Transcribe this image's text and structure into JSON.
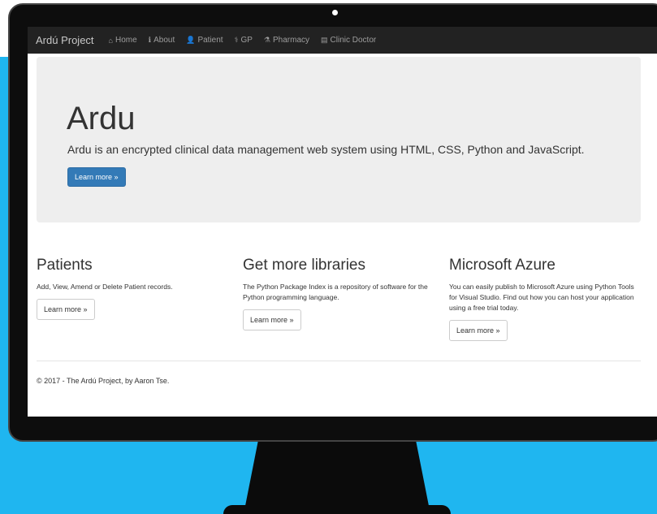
{
  "navbar": {
    "brand": "Ardú Project",
    "items": [
      {
        "icon": "home-icon",
        "glyph": "⌂",
        "label": "Home"
      },
      {
        "icon": "info-icon",
        "glyph": "ℹ",
        "label": "About"
      },
      {
        "icon": "user-icon",
        "glyph": "👤",
        "label": "Patient"
      },
      {
        "icon": "doctor-icon",
        "glyph": "⚕",
        "label": "GP"
      },
      {
        "icon": "flask-icon",
        "glyph": "⚗",
        "label": "Pharmacy"
      },
      {
        "icon": "id-card-icon",
        "glyph": "▤",
        "label": "Clinic Doctor"
      }
    ]
  },
  "jumbotron": {
    "title": "Ardu",
    "lead": "Ardu is an encrypted clinical data management web system using HTML, CSS, Python and JavaScript.",
    "button": "Learn more »"
  },
  "columns": [
    {
      "title": "Patients",
      "text": "Add, View, Amend or Delete Patient records.",
      "button": "Learn more »"
    },
    {
      "title": "Get more libraries",
      "text": "The Python Package Index is a repository of software for the Python programming language.",
      "button": "Learn more »"
    },
    {
      "title": "Microsoft Azure",
      "text": "You can easily publish to Microsoft Azure using Python Tools for Visual Studio. Find out how you can host your application using a free trial today.",
      "button": "Learn more »"
    }
  ],
  "footer": {
    "text": "© 2017 - The Ardú Project, by Aaron Tse."
  },
  "colors": {
    "backdrop": "#1fb6f0",
    "navbar": "#222222",
    "primary": "#337ab7",
    "jumbotron": "#eeeeee"
  }
}
